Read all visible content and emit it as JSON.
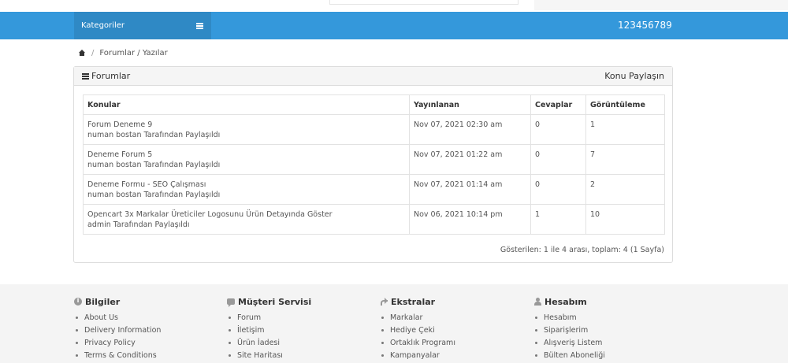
{
  "navbar": {
    "categories_label": "Kategoriler",
    "phone": "123456789",
    "color": "#3498db"
  },
  "breadcrumb": {
    "home_icon": "home-icon",
    "path": "Forumlar / Yazılar"
  },
  "panel": {
    "title": "Forumlar",
    "share_label": "Konu Paylaşın",
    "table": {
      "headers": [
        "Konular",
        "Yayınlanan",
        "Cevaplar",
        "Görüntüleme"
      ],
      "rows": [
        {
          "title": "Forum Deneme 9",
          "author": "numan bostan Tarafından Paylaşıldı",
          "date": "Nov 07, 2021 02:30 am",
          "replies": "0",
          "views": "1"
        },
        {
          "title": "Deneme Forum 5",
          "author": "numan bostan Tarafından Paylaşıldı",
          "date": "Nov 07, 2021 01:22 am",
          "replies": "0",
          "views": "7"
        },
        {
          "title": "Deneme Formu - SEO Çalışması",
          "author": "numan bostan Tarafından Paylaşıldı",
          "date": "Nov 07, 2021 01:14 am",
          "replies": "0",
          "views": "2"
        },
        {
          "title": "Opencart 3x Markalar Üreticiler Logosunu Ürün Detayında Göster",
          "author": "admin Tarafından Paylaşıldı",
          "date": "Nov 06, 2021 10:14 pm",
          "replies": "1",
          "views": "10"
        }
      ]
    },
    "pagination_text": "Gösterilen: 1 ile 4 arası, toplam: 4 (1 Sayfa)"
  },
  "footer": {
    "columns": [
      {
        "heading": "Bilgiler",
        "icon": "info-icon",
        "items": [
          "About Us",
          "Delivery Information",
          "Privacy Policy",
          "Terms & Conditions"
        ]
      },
      {
        "heading": "Müşteri Servisi",
        "icon": "chat-icon",
        "items": [
          "Forum",
          "İletişim",
          "Ürün İadesi",
          "Site Haritası"
        ]
      },
      {
        "heading": "Ekstralar",
        "icon": "share-icon",
        "items": [
          "Markalar",
          "Hediye Çeki",
          "Ortaklık Programı",
          "Kampanyalar"
        ]
      },
      {
        "heading": "Hesabım",
        "icon": "user-icon",
        "items": [
          "Hesabım",
          "Siparişlerim",
          "Alışveriş Listem",
          "Bülten Aboneliği"
        ]
      }
    ]
  }
}
